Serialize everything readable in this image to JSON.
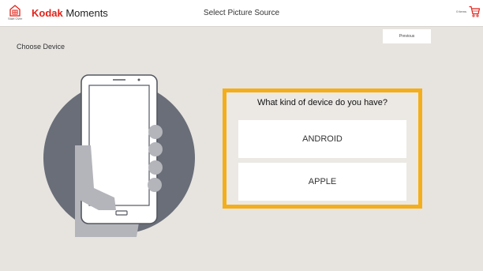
{
  "header": {
    "home_label": "Start Over",
    "brand_bold": "Kodak",
    "brand_rest": " Moments",
    "title": "Select Picture Source",
    "cart_count": "0 items"
  },
  "nav": {
    "previous_label": "Previous"
  },
  "main": {
    "heading": "Choose Device",
    "question": "What kind of device do you have?",
    "options": [
      "ANDROID",
      "APPLE"
    ]
  },
  "colors": {
    "brand_red": "#e2231a",
    "highlight": "#f4ae1a",
    "background": "#e7e4e0",
    "circle": "#6a6e78"
  },
  "icons": [
    "home-icon",
    "cart-icon",
    "phone-in-hand-illustration"
  ]
}
